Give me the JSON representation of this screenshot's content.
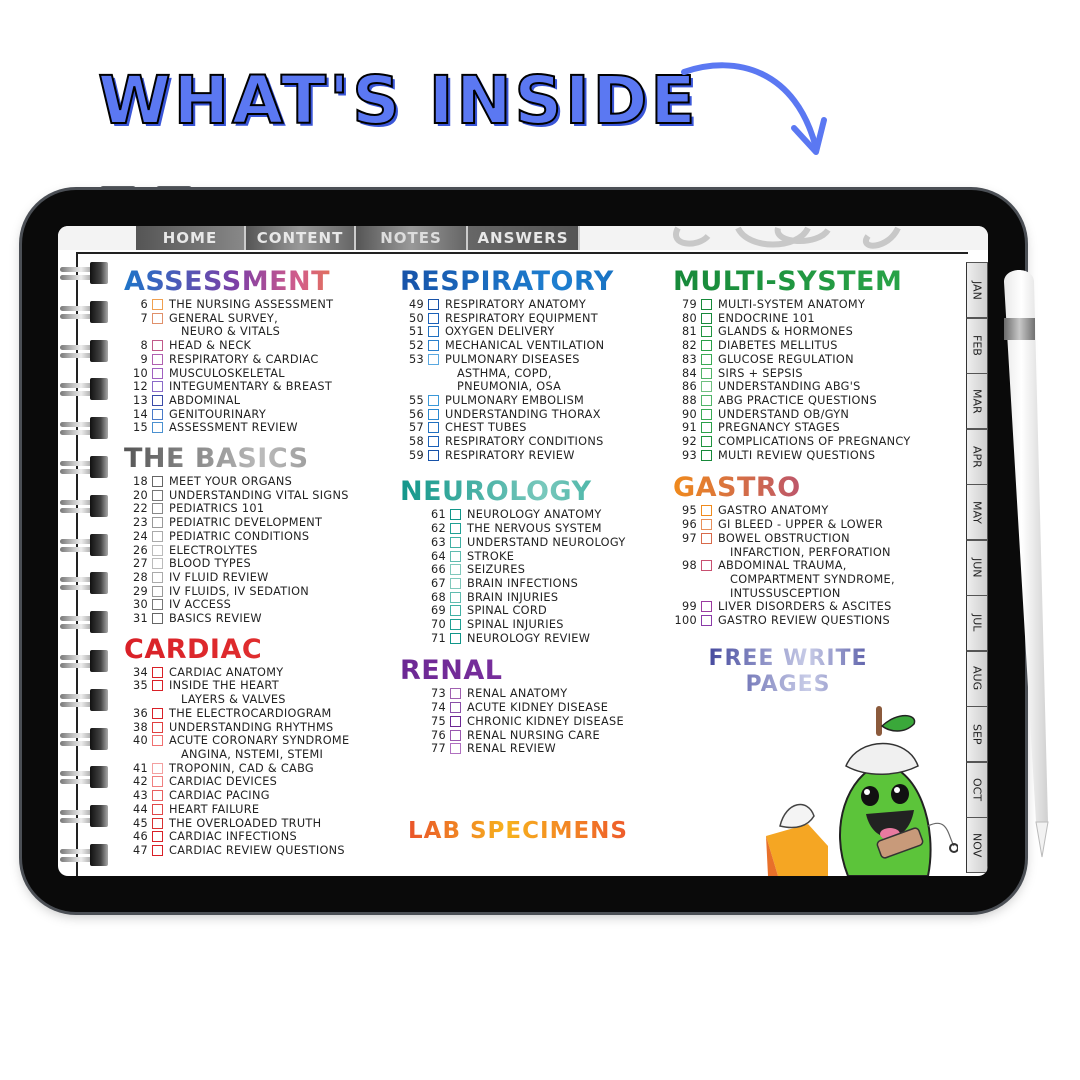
{
  "headline": "What's inside",
  "colors": {
    "headline": "#5b78f2",
    "arrow": "#5b78f2",
    "assessment": "#7d3fa6",
    "basics": "#888888",
    "cardiac": "#d92027",
    "respiratory": "#1752a8",
    "neurology": "#11968a",
    "renal": "#6c2894",
    "multi_system": "#17893a",
    "gastro": "#b24b7b"
  },
  "nav_tabs": [
    {
      "label": "Home"
    },
    {
      "label": "Content"
    },
    {
      "label": "Notes"
    },
    {
      "label": "Answers"
    }
  ],
  "month_tabs": [
    "JAN",
    "FEB",
    "MAR",
    "APR",
    "MAY",
    "JUN",
    "JUL",
    "AUG",
    "SEP",
    "OCT",
    "NOV"
  ],
  "sections": {
    "assessment": {
      "title": "Assessment",
      "items": [
        {
          "page": "6",
          "label": "THE NURSING ASSESSMENT",
          "color": "#f0a050"
        },
        {
          "page": "7",
          "label": "GENERAL SURVEY,",
          "sub": "NEURO & VITALS",
          "color": "#e0906a"
        },
        {
          "page": "8",
          "label": "HEAD & NECK",
          "color": "#c05a8a"
        },
        {
          "page": "9",
          "label": "RESPIRATORY & CARDIAC",
          "color": "#b060b0"
        },
        {
          "page": "10",
          "label": "MUSCULOSKELETAL",
          "color": "#a060c0"
        },
        {
          "page": "12",
          "label": "INTEGUMENTARY & BREAST",
          "color": "#8a6ac8"
        },
        {
          "page": "13",
          "label": "ABDOMINAL",
          "color": "#3a4aa8"
        },
        {
          "page": "14",
          "label": "GENITOURINARY",
          "color": "#4a7ac8"
        },
        {
          "page": "15",
          "label": "ASSESSMENT REVIEW",
          "color": "#4a90d0"
        }
      ]
    },
    "basics": {
      "title": "The Basics",
      "items": [
        {
          "page": "18",
          "label": "MEET YOUR ORGANS",
          "color": "#666666"
        },
        {
          "page": "20",
          "label": "UNDERSTANDING VITAL SIGNS",
          "color": "#777777"
        },
        {
          "page": "22",
          "label": "PEDIATRICS 101",
          "color": "#888888"
        },
        {
          "page": "23",
          "label": "PEDIATRIC DEVELOPMENT",
          "color": "#999999"
        },
        {
          "page": "24",
          "label": "PEDIATRIC CONDITIONS",
          "color": "#aaaaaa"
        },
        {
          "page": "26",
          "label": "ELECTROLYTES",
          "color": "#bbbbbb"
        },
        {
          "page": "27",
          "label": "BLOOD TYPES",
          "color": "#bbbbbb"
        },
        {
          "page": "28",
          "label": "IV FLUID REVIEW",
          "color": "#aaaaaa"
        },
        {
          "page": "29",
          "label": "IV FLUIDS, IV SEDATION",
          "color": "#999999"
        },
        {
          "page": "30",
          "label": "IV ACCESS",
          "color": "#777777"
        },
        {
          "page": "31",
          "label": "BASICS REVIEW",
          "color": "#666666"
        }
      ]
    },
    "cardiac": {
      "title": "Cardiac",
      "items": [
        {
          "page": "34",
          "label": "CARDIAC ANATOMY",
          "color": "#d92027"
        },
        {
          "page": "35",
          "label": "INSIDE THE HEART",
          "sub": "LAYERS & VALVES",
          "color": "#d92027"
        },
        {
          "page": "36",
          "label": "THE ELECTROCARDIOGRAM",
          "color": "#d92027"
        },
        {
          "page": "38",
          "label": "UNDERSTANDING RHYTHMS",
          "color": "#e04040"
        },
        {
          "page": "40",
          "label": "ACUTE CORONARY SYNDROME",
          "sub": "ANGINA, NSTEMI, STEMI",
          "color": "#f07070"
        },
        {
          "page": "41",
          "label": "TROPONIN, CAD & CABG",
          "color": "#f4a0a0"
        },
        {
          "page": "42",
          "label": "CARDIAC DEVICES",
          "color": "#f08080"
        },
        {
          "page": "43",
          "label": "CARDIAC PACING",
          "color": "#e86060"
        },
        {
          "page": "44",
          "label": "HEART FAILURE",
          "color": "#e04848"
        },
        {
          "page": "45",
          "label": "THE OVERLOADED TRUTH",
          "color": "#d83030"
        },
        {
          "page": "46",
          "label": "CARDIAC INFECTIONS",
          "color": "#d92027"
        },
        {
          "page": "47",
          "label": "CARDIAC REVIEW QUESTIONS",
          "color": "#d92027"
        }
      ]
    },
    "respiratory": {
      "title": "Respiratory",
      "items": [
        {
          "page": "49",
          "label": "RESPIRATORY ANATOMY",
          "color": "#1752a8"
        },
        {
          "page": "50",
          "label": "RESPIRATORY EQUIPMENT",
          "color": "#1a60b8"
        },
        {
          "page": "51",
          "label": "OXYGEN DELIVERY",
          "color": "#2070c0"
        },
        {
          "page": "52",
          "label": "MECHANICAL VENTILATION",
          "color": "#2a80cc"
        },
        {
          "page": "53",
          "label": "PULMONARY DISEASES",
          "sub": "ASTHMA, COPD,",
          "sub2": "PNEUMONIA, OSA",
          "color": "#5aa8e0"
        },
        {
          "page": "55",
          "label": "PULMONARY EMBOLISM",
          "color": "#3a98d8"
        },
        {
          "page": "56",
          "label": "UNDERSTANDING THORAX",
          "color": "#2a88d0"
        },
        {
          "page": "57",
          "label": "CHEST TUBES",
          "color": "#2070c0"
        },
        {
          "page": "58",
          "label": "RESPIRATORY CONDITIONS",
          "color": "#1a60b8"
        },
        {
          "page": "59",
          "label": "RESPIRATORY REVIEW",
          "color": "#1752a8"
        }
      ]
    },
    "neurology": {
      "title": "Neurology",
      "items": [
        {
          "page": "61",
          "label": "NEUROLOGY ANATOMY",
          "color": "#11968a"
        },
        {
          "page": "62",
          "label": "THE NERVOUS SYSTEM",
          "color": "#20a094"
        },
        {
          "page": "63",
          "label": "UNDERSTAND NEUROLOGY",
          "color": "#40b0a4"
        },
        {
          "page": "64",
          "label": "STROKE",
          "color": "#60bcb0"
        },
        {
          "page": "66",
          "label": "SEIZURES",
          "color": "#80c8bc"
        },
        {
          "page": "67",
          "label": "BRAIN INFECTIONS",
          "color": "#80c8bc"
        },
        {
          "page": "68",
          "label": "BRAIN INJURIES",
          "color": "#60bcb0"
        },
        {
          "page": "69",
          "label": "SPINAL CORD",
          "color": "#40b0a4"
        },
        {
          "page": "70",
          "label": "SPINAL INJURIES",
          "color": "#20a094"
        },
        {
          "page": "71",
          "label": "NEUROLOGY REVIEW",
          "color": "#11968a"
        }
      ]
    },
    "renal": {
      "title": "Renal",
      "items": [
        {
          "page": "73",
          "label": "RENAL ANATOMY",
          "color": "#a060b0"
        },
        {
          "page": "74",
          "label": "ACUTE KIDNEY DISEASE",
          "color": "#8a50a8"
        },
        {
          "page": "75",
          "label": "CHRONIC KIDNEY DISEASE",
          "color": "#6c2894"
        },
        {
          "page": "76",
          "label": "RENAL NURSING CARE",
          "color": "#9a58b0"
        },
        {
          "page": "77",
          "label": "RENAL REVIEW",
          "color": "#b070c0"
        }
      ]
    },
    "multi_system": {
      "title": "Multi-System",
      "items": [
        {
          "page": "79",
          "label": "MULTI-SYSTEM ANATOMY",
          "color": "#17893a"
        },
        {
          "page": "80",
          "label": "ENDOCRINE 101",
          "color": "#17893a"
        },
        {
          "page": "81",
          "label": "GLANDS & HORMONES",
          "color": "#1f943f"
        },
        {
          "page": "82",
          "label": "DIABETES MELLITUS",
          "color": "#2aa048"
        },
        {
          "page": "83",
          "label": "GLUCOSE REGULATION",
          "color": "#3aaa55"
        },
        {
          "page": "84",
          "label": "SIRS + SEPSIS",
          "color": "#50b468"
        },
        {
          "page": "86",
          "label": "UNDERSTANDING ABG'S",
          "color": "#70c080"
        },
        {
          "page": "88",
          "label": "ABG PRACTICE QUESTIONS",
          "color": "#50b468"
        },
        {
          "page": "90",
          "label": "UNDERSTAND OB/GYN",
          "color": "#3aaa55"
        },
        {
          "page": "91",
          "label": "PREGNANCY STAGES",
          "color": "#2aa048"
        },
        {
          "page": "92",
          "label": "COMPLICATIONS OF PREGNANCY",
          "color": "#1f943f"
        },
        {
          "page": "93",
          "label": "MULTI REVIEW QUESTIONS",
          "color": "#17893a"
        }
      ]
    },
    "gastro": {
      "title": "Gastro",
      "items": [
        {
          "page": "95",
          "label": "GASTRO ANATOMY",
          "color": "#f08a1c"
        },
        {
          "page": "96",
          "label": "GI BLEED - UPPER & LOWER",
          "color": "#e8905a"
        },
        {
          "page": "97",
          "label": "BOWEL OBSTRUCTION",
          "sub": "INFARCTION, PERFORATION",
          "color": "#d86a4a"
        },
        {
          "page": "98",
          "label": "ABDOMINAL TRAUMA,",
          "sub": "COMPARTMENT SYNDROME,",
          "sub2": "INTUSSUSCEPTION",
          "color": "#c85070"
        },
        {
          "page": "99",
          "label": "LIVER DISORDERS & ASCITES",
          "color": "#9a3aa0"
        },
        {
          "page": "100",
          "label": "GASTRO REVIEW QUESTIONS",
          "color": "#8a3aa8"
        }
      ]
    }
  },
  "lab_specimens": "Lab Specimens",
  "free_write": {
    "line1": "Free Write",
    "line2": "Pages"
  }
}
